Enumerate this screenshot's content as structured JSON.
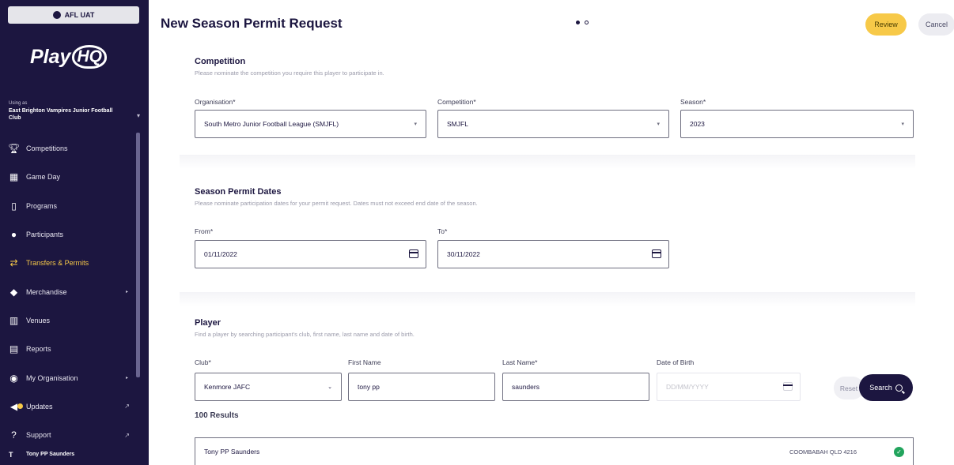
{
  "sidebar": {
    "env_label": "AFL UAT",
    "logo_play": "Play",
    "logo_hq": "HQ",
    "org_label": "Using as",
    "org_name": "East Brighton Vampires Junior Football Club",
    "items": [
      {
        "label": "Competitions",
        "icon": "trophy-icon"
      },
      {
        "label": "Game Day",
        "icon": "scoreboard-icon"
      },
      {
        "label": "Programs",
        "icon": "book-icon"
      },
      {
        "label": "Participants",
        "icon": "people-icon"
      },
      {
        "label": "Transfers & Permits",
        "icon": "transfer-arrows-icon"
      },
      {
        "label": "Merchandise",
        "icon": "shirt-icon"
      },
      {
        "label": "Venues",
        "icon": "stadium-icon"
      },
      {
        "label": "Reports",
        "icon": "chart-icon"
      },
      {
        "label": "My Organisation",
        "icon": "globe-icon"
      },
      {
        "label": "Updates",
        "icon": "megaphone-icon"
      },
      {
        "label": "Support",
        "icon": "help-icon"
      }
    ],
    "user_name": "Tony PP Saunders",
    "user_initial": "T"
  },
  "header": {
    "title": "New Season Permit Request",
    "review_label": "Review",
    "cancel_label": "Cancel"
  },
  "competition": {
    "title": "Competition",
    "description": "Please nominate the competition you require this player to participate in.",
    "organisation_label": "Organisation*",
    "organisation_value": "South Metro Junior Football League (SMJFL)",
    "competition_label": "Competition*",
    "competition_value": "SMJFL",
    "season_label": "Season*",
    "season_value": "2023"
  },
  "dates": {
    "title": "Season Permit Dates",
    "description": "Please nominate participation dates for your permit request. Dates must not exceed end date of the season.",
    "from_label": "From*",
    "from_value": "01/11/2022",
    "to_label": "To*",
    "to_value": "30/11/2022"
  },
  "player": {
    "title": "Player",
    "description": "Find a player by searching participant's club, first name, last name and date of birth.",
    "club_label": "Club*",
    "club_value": "Kenmore JAFC",
    "first_name_label": "First Name",
    "first_name_value": "tony pp",
    "last_name_label": "Last Name*",
    "last_name_value": "saunders",
    "dob_label": "Date of Birth",
    "dob_placeholder": "DD/MM/YYYY",
    "reset_label": "Reset",
    "search_label": "Search"
  },
  "results": {
    "count_label": "100 Results",
    "rows": [
      {
        "name": "Tony PP Saunders",
        "location": "COOMBABAH QLD 4216"
      }
    ]
  },
  "colors": {
    "sidebar_bg": "#1c1640",
    "accent": "#f7c948",
    "success": "#22a45d"
  }
}
